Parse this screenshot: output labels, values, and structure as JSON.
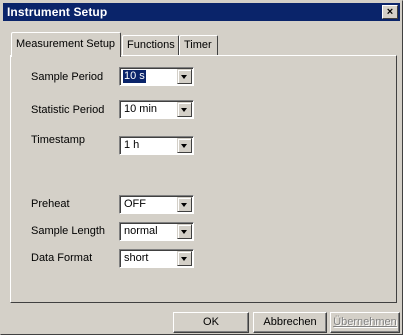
{
  "window": {
    "title": "Instrument Setup",
    "close_glyph": "×"
  },
  "tabs": [
    {
      "label": "Measurement Setup",
      "active": true
    },
    {
      "label": "Functions",
      "active": false
    },
    {
      "label": "Timer",
      "active": false
    }
  ],
  "fields": {
    "sample_period": {
      "label": "Sample Period",
      "value": "10 s"
    },
    "statistic_period": {
      "label": "Statistic Period",
      "value": "10 min"
    },
    "timestamp": {
      "label": "Timestamp",
      "value": "1 h"
    },
    "preheat": {
      "label": "Preheat",
      "value": "OFF"
    },
    "sample_length": {
      "label": "Sample Length",
      "value": "normal"
    },
    "data_format": {
      "label": "Data Format",
      "value": "short"
    }
  },
  "buttons": {
    "ok": "OK",
    "cancel": "Abbrechen",
    "apply": "Übernehmen"
  },
  "colors": {
    "titlebar": "#0a246a",
    "face": "#d4d0c8",
    "selection": "#0a246a",
    "disabled_text": "#808080"
  }
}
